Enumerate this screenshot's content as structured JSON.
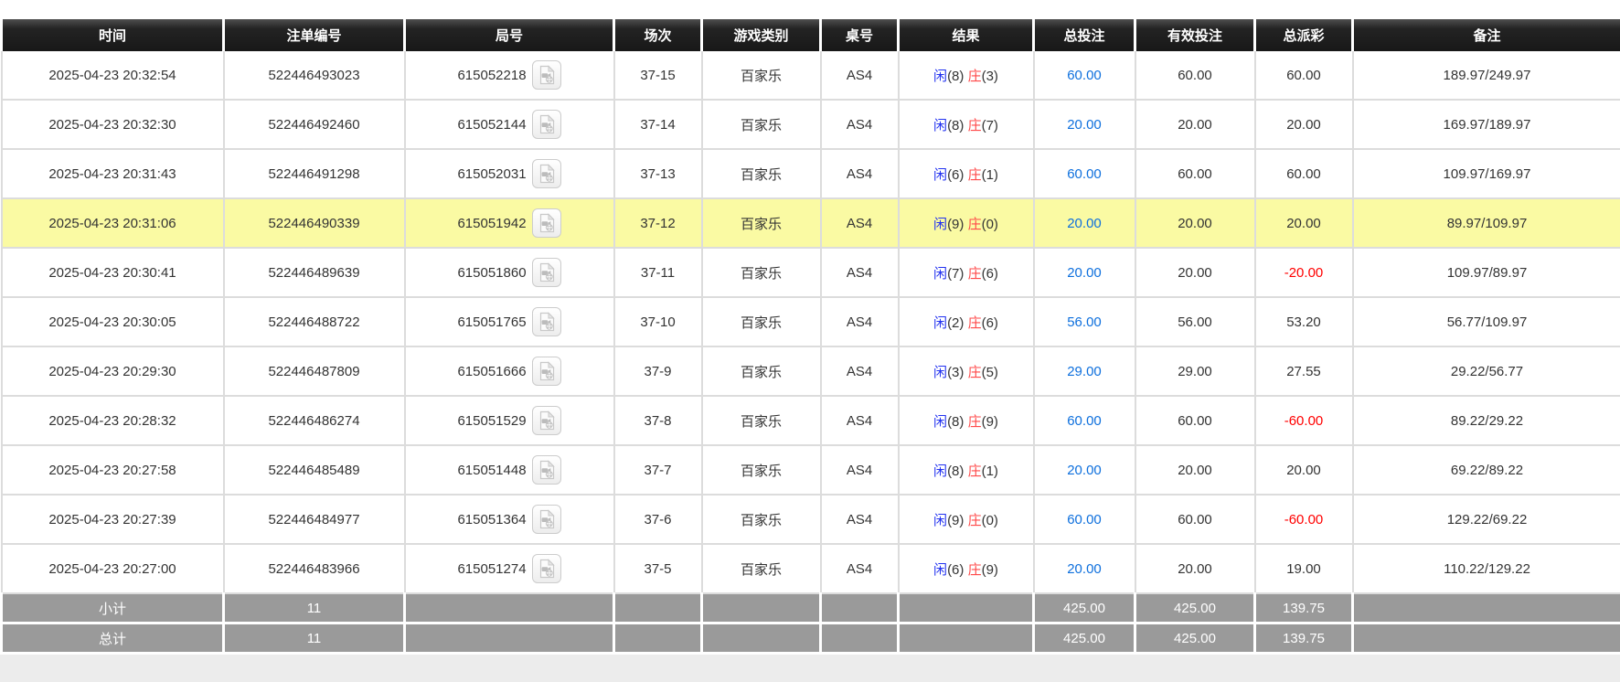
{
  "columns": [
    "时间",
    "注单编号",
    "局号",
    "场次",
    "游戏类别",
    "桌号",
    "结果",
    "总投注",
    "有效投注",
    "总派彩",
    "备注"
  ],
  "rows": [
    {
      "time": "2025-04-23 20:32:54",
      "bet_id": "522446493023",
      "round_id": "615052218",
      "session": "37-15",
      "game_type": "百家乐",
      "table_no": "AS4",
      "result": {
        "player": "闲",
        "player_pts": "(8)",
        "banker": "庄",
        "banker_pts": "(3)"
      },
      "total_bet": "60.00",
      "valid_bet": "60.00",
      "payout": "60.00",
      "remark": "189.97/249.97",
      "highlighted": false
    },
    {
      "time": "2025-04-23 20:32:30",
      "bet_id": "522446492460",
      "round_id": "615052144",
      "session": "37-14",
      "game_type": "百家乐",
      "table_no": "AS4",
      "result": {
        "player": "闲",
        "player_pts": "(8)",
        "banker": "庄",
        "banker_pts": "(7)"
      },
      "total_bet": "20.00",
      "valid_bet": "20.00",
      "payout": "20.00",
      "remark": "169.97/189.97",
      "highlighted": false
    },
    {
      "time": "2025-04-23 20:31:43",
      "bet_id": "522446491298",
      "round_id": "615052031",
      "session": "37-13",
      "game_type": "百家乐",
      "table_no": "AS4",
      "result": {
        "player": "闲",
        "player_pts": "(6)",
        "banker": "庄",
        "banker_pts": "(1)"
      },
      "total_bet": "60.00",
      "valid_bet": "60.00",
      "payout": "60.00",
      "remark": "109.97/169.97",
      "highlighted": false
    },
    {
      "time": "2025-04-23 20:31:06",
      "bet_id": "522446490339",
      "round_id": "615051942",
      "session": "37-12",
      "game_type": "百家乐",
      "table_no": "AS4",
      "result": {
        "player": "闲",
        "player_pts": "(9)",
        "banker": "庄",
        "banker_pts": "(0)"
      },
      "total_bet": "20.00",
      "valid_bet": "20.00",
      "payout": "20.00",
      "remark": "89.97/109.97",
      "highlighted": true
    },
    {
      "time": "2025-04-23 20:30:41",
      "bet_id": "522446489639",
      "round_id": "615051860",
      "session": "37-11",
      "game_type": "百家乐",
      "table_no": "AS4",
      "result": {
        "player": "闲",
        "player_pts": "(7)",
        "banker": "庄",
        "banker_pts": "(6)"
      },
      "total_bet": "20.00",
      "valid_bet": "20.00",
      "payout": "-20.00",
      "remark": "109.97/89.97",
      "highlighted": false
    },
    {
      "time": "2025-04-23 20:30:05",
      "bet_id": "522446488722",
      "round_id": "615051765",
      "session": "37-10",
      "game_type": "百家乐",
      "table_no": "AS4",
      "result": {
        "player": "闲",
        "player_pts": "(2)",
        "banker": "庄",
        "banker_pts": "(6)"
      },
      "total_bet": "56.00",
      "valid_bet": "56.00",
      "payout": "53.20",
      "remark": "56.77/109.97",
      "highlighted": false
    },
    {
      "time": "2025-04-23 20:29:30",
      "bet_id": "522446487809",
      "round_id": "615051666",
      "session": "37-9",
      "game_type": "百家乐",
      "table_no": "AS4",
      "result": {
        "player": "闲",
        "player_pts": "(3)",
        "banker": "庄",
        "banker_pts": "(5)"
      },
      "total_bet": "29.00",
      "valid_bet": "29.00",
      "payout": "27.55",
      "remark": "29.22/56.77",
      "highlighted": false
    },
    {
      "time": "2025-04-23 20:28:32",
      "bet_id": "522446486274",
      "round_id": "615051529",
      "session": "37-8",
      "game_type": "百家乐",
      "table_no": "AS4",
      "result": {
        "player": "闲",
        "player_pts": "(8)",
        "banker": "庄",
        "banker_pts": "(9)"
      },
      "total_bet": "60.00",
      "valid_bet": "60.00",
      "payout": "-60.00",
      "remark": "89.22/29.22",
      "highlighted": false
    },
    {
      "time": "2025-04-23 20:27:58",
      "bet_id": "522446485489",
      "round_id": "615051448",
      "session": "37-7",
      "game_type": "百家乐",
      "table_no": "AS4",
      "result": {
        "player": "闲",
        "player_pts": "(8)",
        "banker": "庄",
        "banker_pts": "(1)"
      },
      "total_bet": "20.00",
      "valid_bet": "20.00",
      "payout": "20.00",
      "remark": "69.22/89.22",
      "highlighted": false
    },
    {
      "time": "2025-04-23 20:27:39",
      "bet_id": "522446484977",
      "round_id": "615051364",
      "session": "37-6",
      "game_type": "百家乐",
      "table_no": "AS4",
      "result": {
        "player": "闲",
        "player_pts": "(9)",
        "banker": "庄",
        "banker_pts": "(0)"
      },
      "total_bet": "60.00",
      "valid_bet": "60.00",
      "payout": "-60.00",
      "remark": "129.22/69.22",
      "highlighted": false
    },
    {
      "time": "2025-04-23 20:27:00",
      "bet_id": "522446483966",
      "round_id": "615051274",
      "session": "37-5",
      "game_type": "百家乐",
      "table_no": "AS4",
      "result": {
        "player": "闲",
        "player_pts": "(6)",
        "banker": "庄",
        "banker_pts": "(9)"
      },
      "total_bet": "20.00",
      "valid_bet": "20.00",
      "payout": "19.00",
      "remark": "110.22/129.22",
      "highlighted": false
    }
  ],
  "subtotal": {
    "label": "小计",
    "count": "11",
    "total_bet": "425.00",
    "valid_bet": "425.00",
    "payout": "139.75"
  },
  "grandtotal": {
    "label": "总计",
    "count": "11",
    "total_bet": "425.00",
    "valid_bet": "425.00",
    "payout": "139.75"
  },
  "icons": {
    "round_replay": "video-file-icon"
  },
  "colors": {
    "header_bg": "#1f1f1f",
    "footer_bg": "#9a9a9a",
    "highlight_yellow": "#fafaa3",
    "bet_link_blue": "#0d6fdd",
    "player_blue": "#2232f0",
    "banker_red": "#ff4a4a",
    "negative_red": "#ff0000"
  }
}
